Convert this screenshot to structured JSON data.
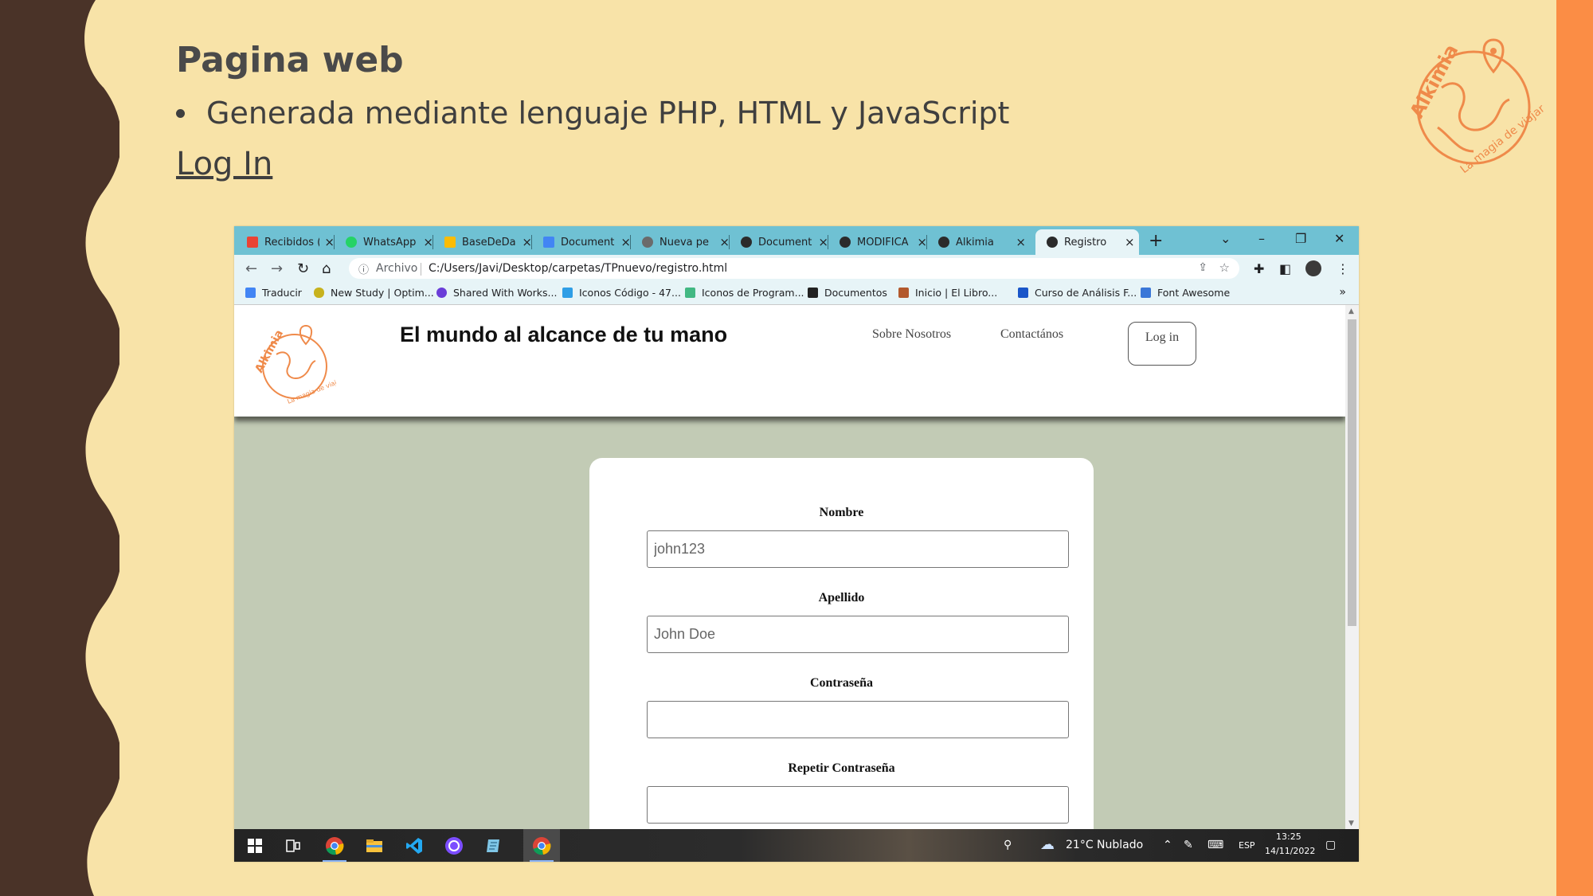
{
  "slide": {
    "title": "Pagina web",
    "bullet": "Generada mediante lenguaje PHP, HTML y JavaScript",
    "link": "Log In",
    "logo_text": "Alkimia",
    "logo_tagline": "La magia de viajar"
  },
  "browser": {
    "tabs": [
      {
        "label": "Recibidos (",
        "icon": "gmail-icon"
      },
      {
        "label": "WhatsApp",
        "icon": "whatsapp-icon"
      },
      {
        "label": "BaseDeDa",
        "icon": "drive-icon"
      },
      {
        "label": "Document",
        "icon": "docs-icon"
      },
      {
        "label": "Nueva pe",
        "icon": "chrome-icon"
      },
      {
        "label": "Document",
        "icon": "globe-icon"
      },
      {
        "label": "MODIFICA",
        "icon": "globe-icon"
      },
      {
        "label": "Alkimia",
        "icon": "globe-icon"
      },
      {
        "label": "Registro",
        "icon": "globe-icon"
      }
    ],
    "address": {
      "security_label": "Archivo",
      "url": "C:/Users/Javi/Desktop/carpetas/TPnuevo/registro.html"
    },
    "bookmarks": [
      "Traducir",
      "New Study | Optim...",
      "Shared With Works...",
      "Iconos Código - 47...",
      "Iconos de Program...",
      "Documentos",
      "Inicio | El Libro...",
      "Curso de Análisis F...",
      "Font Awesome"
    ],
    "bookmarks_more": "»"
  },
  "site": {
    "logo_text": "Alkimia",
    "logo_tagline": "La magia de viajar",
    "title": "El mundo al alcance de tu mano",
    "nav": [
      "Sobre Nosotros",
      "Contactános"
    ],
    "login_label": "Log in",
    "form": {
      "fields": [
        {
          "label": "Nombre",
          "placeholder": "john123"
        },
        {
          "label": "Apellido",
          "placeholder": "John Doe"
        },
        {
          "label": "Contraseña",
          "placeholder": ""
        },
        {
          "label": "Repetir Contraseña",
          "placeholder": ""
        }
      ]
    }
  },
  "taskbar": {
    "weather": "21°C  Nublado",
    "lang": "ESP",
    "time": "13:25",
    "date": "14/11/2022"
  },
  "colors": {
    "slide_bg": "#f8e3a8",
    "left_band": "#4a3328",
    "right_band": "#fb8d45",
    "tab_bar": "#6fc1d3",
    "page_bg": "#c2cbb5",
    "logo_orange": "#ef8a4a"
  }
}
